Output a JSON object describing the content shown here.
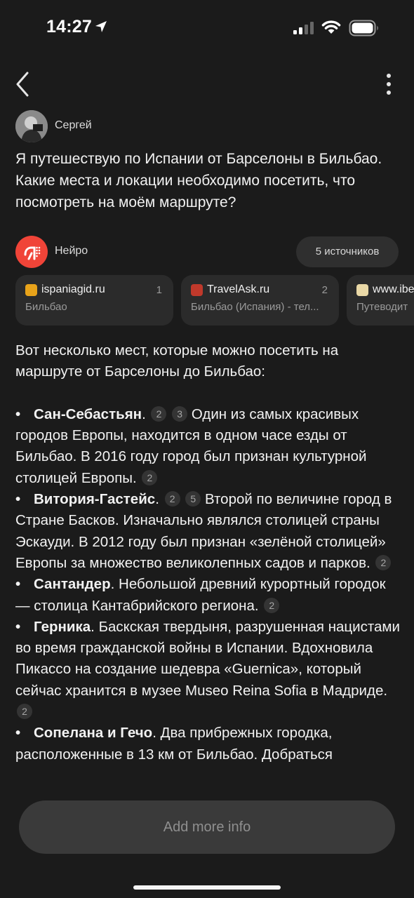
{
  "status_bar": {
    "time": "14:27"
  },
  "user": {
    "name": "Сергей"
  },
  "question": "Я путешествую по Испании от Барселоны в Бильбао. Какие места и локации необходимо посетить, что посмотреть на моём маршруте?",
  "ai": {
    "name": "Нейро",
    "sources_button": "5 источников"
  },
  "sources": [
    {
      "site": "ispaniagid.ru",
      "num": "1",
      "desc": "Бильбао",
      "fav_color": "#e8a31a"
    },
    {
      "site": "TravelAsk.ru",
      "num": "2",
      "desc": "Бильбао (Испания) - тел...",
      "fav_color": "#c0392b"
    },
    {
      "site": "www.ibe",
      "num": "",
      "desc": "Путеводит",
      "fav_color": "#e9d8a6"
    }
  ],
  "answer": {
    "intro": "Вот несколько мест, которые можно посетить на маршруте от Барселоны до Бильбао:",
    "bullet_char": "•",
    "items": [
      {
        "title": "Сан-Себастьян",
        "cites": [
          "2",
          "3"
        ],
        "text": "Один из самых красивых городов Европы, находится в одном часе езды от Бильбао. В 2016 году город был признан культурной столицей Европы.",
        "end_cite": "2"
      },
      {
        "title": "Витория-Гастейс",
        "cites": [
          "2",
          "5"
        ],
        "text": "Второй по величине город в Стране Басков. Изначально являлся столицей страны Эскауди. В 2012 году был признан «зелёной столицей» Европы за множество великолепных садов и парков.",
        "end_cite": "2"
      },
      {
        "title": "Сантандер",
        "cites": [],
        "text": "Небольшой древний курортный городок — столица Кантабрийского региона.",
        "end_cite": "2"
      },
      {
        "title": "Герника",
        "cites": [],
        "text": "Баскская твердыня, разрушенная нацистами во время гражданской войны в Испании. Вдохновила Пикассо на создание шедевра «Guernica», который сейчас хранится в музее Museo Reina Sofia в Мадриде.",
        "end_cite": "2"
      },
      {
        "title": "Сопелана и Гечо",
        "cites": [],
        "text": "Два прибрежных городка, расположенные в 13 км от Бильбао. Добраться",
        "end_cite": ""
      }
    ]
  },
  "input": {
    "placeholder": "Add more info"
  },
  "colors": {
    "background": "#1b1b1b",
    "ai_logo": "#f04438",
    "card": "#2b2b2b",
    "input": "#3a3a3a"
  }
}
